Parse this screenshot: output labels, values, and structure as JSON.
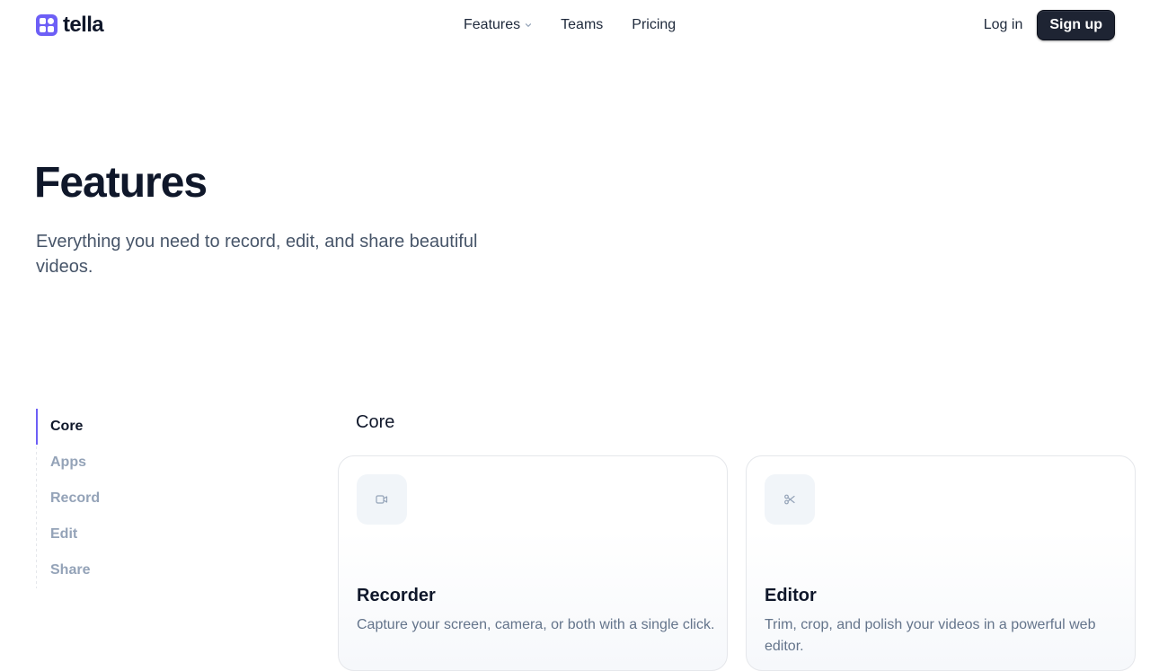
{
  "brand": {
    "name": "tella",
    "accent": "#6d5ff6",
    "logo_icon": "tella-logo-icon"
  },
  "nav": {
    "items": [
      {
        "label": "Features",
        "has_dropdown": true
      },
      {
        "label": "Teams"
      },
      {
        "label": "Pricing"
      }
    ]
  },
  "auth": {
    "login_label": "Log in",
    "signup_label": "Sign up"
  },
  "hero": {
    "title": "Features",
    "subtitle": "Everything you need to record, edit, and share beautiful videos."
  },
  "sidenav": {
    "items": [
      {
        "label": "Core",
        "active": true
      },
      {
        "label": "Apps"
      },
      {
        "label": "Record"
      },
      {
        "label": "Edit"
      },
      {
        "label": "Share"
      }
    ]
  },
  "section": {
    "title": "Core",
    "cards": [
      {
        "icon": "video-camera-icon",
        "title": "Recorder",
        "description": "Capture your screen, camera, or both with a single click."
      },
      {
        "icon": "scissors-icon",
        "title": "Editor",
        "description": "Trim, crop, and polish your videos in a powerful web editor."
      }
    ]
  }
}
